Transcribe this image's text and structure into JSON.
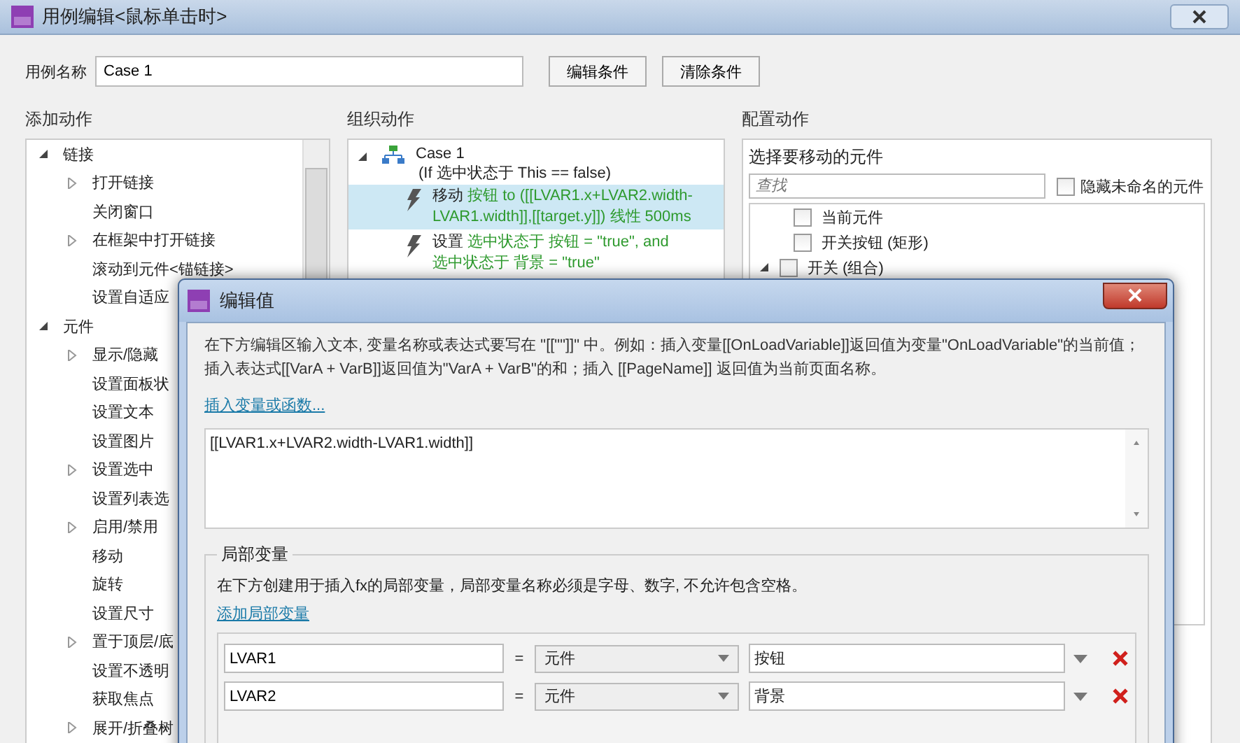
{
  "window": {
    "title": "用例编辑<鼠标单击时>"
  },
  "case_name": {
    "label": "用例名称",
    "value": "Case 1"
  },
  "buttons": [
    "编辑条件",
    "清除条件"
  ],
  "add_actions": {
    "heading": "添加动作",
    "tree": [
      {
        "label": "链接",
        "expanded": true,
        "children": [
          {
            "label": "打开链接",
            "expanded": false
          },
          {
            "label": "关闭窗口"
          },
          {
            "label": "在框架中打开链接",
            "expanded": false
          },
          {
            "label": "滚动到元件<锚链接>"
          },
          {
            "label": "设置自适应"
          }
        ]
      },
      {
        "label": "元件",
        "expanded": true,
        "children": [
          {
            "label": "显示/隐藏",
            "expanded": false
          },
          {
            "label": "设置面板状"
          },
          {
            "label": "设置文本"
          },
          {
            "label": "设置图片"
          },
          {
            "label": "设置选中",
            "expanded": false
          },
          {
            "label": "设置列表选"
          },
          {
            "label": "启用/禁用",
            "expanded": false
          },
          {
            "label": "移动"
          },
          {
            "label": "旋转"
          },
          {
            "label": "设置尺寸"
          },
          {
            "label": "置于顶层/底",
            "expanded": false
          },
          {
            "label": "设置不透明"
          },
          {
            "label": "获取焦点"
          },
          {
            "label": "展开/折叠树",
            "expanded": false
          }
        ]
      }
    ]
  },
  "organize": {
    "heading": "组织动作",
    "case": {
      "label": "Case 1",
      "condition": "(If 选中状态于 This == false)",
      "expanded": true
    },
    "actions": [
      {
        "selected": true,
        "lines": [
          [
            {
              "kind": "verb",
              "text": "移动 "
            },
            {
              "kind": "value",
              "text": "按钮 to ([[LVAR1.x+LVAR2.width-"
            }
          ],
          [
            {
              "kind": "value",
              "text": "LVAR1.width]],[[target.y]]) 线性 500ms"
            }
          ]
        ]
      },
      {
        "selected": false,
        "lines": [
          [
            {
              "kind": "verb",
              "text": "设置 "
            },
            {
              "kind": "value",
              "text": "选中状态于 按钮 = \"true\", and"
            }
          ],
          [
            {
              "kind": "value",
              "text": "选中状态于 背景 = \"true\""
            }
          ]
        ]
      }
    ]
  },
  "configure": {
    "heading": "配置动作",
    "prompt": "选择要移动的元件",
    "search": {
      "placeholder": "查找"
    },
    "hide_unnamed": {
      "label": "隐藏未命名的元件",
      "checked": false
    },
    "targets": [
      {
        "label": "当前元件",
        "checked": false
      },
      {
        "label": "开关按钮 (矩形)",
        "checked": false
      },
      {
        "label": "开关 (组合)",
        "checked": false,
        "expanded": true
      }
    ]
  },
  "dialog": {
    "title": "编辑值",
    "description": "在下方编辑区输入文本, 变量名称或表达式要写在 \"[[\"\"]]\" 中。例如：插入变量[[OnLoadVariable]]返回值为变量\"OnLoadVariable\"的当前值；插入表达式[[VarA + VarB]]返回值为\"VarA + VarB\"的和；插入 [[PageName]] 返回值为当前页面名称。",
    "insert_link": "插入变量或函数...",
    "expression": "[[LVAR1.x+LVAR2.width-LVAR1.width]]",
    "local_vars": {
      "legend": "局部变量",
      "description": "在下方创建用于插入fx的局部变量，局部变量名称必须是字母、数字, 不允许包含空格。",
      "add_link": "添加局部变量",
      "rows": [
        {
          "name": "LVAR1",
          "equals": "=",
          "type": "元件",
          "target": "按钮"
        },
        {
          "name": "LVAR2",
          "equals": "=",
          "type": "元件",
          "target": "背景"
        }
      ]
    }
  }
}
